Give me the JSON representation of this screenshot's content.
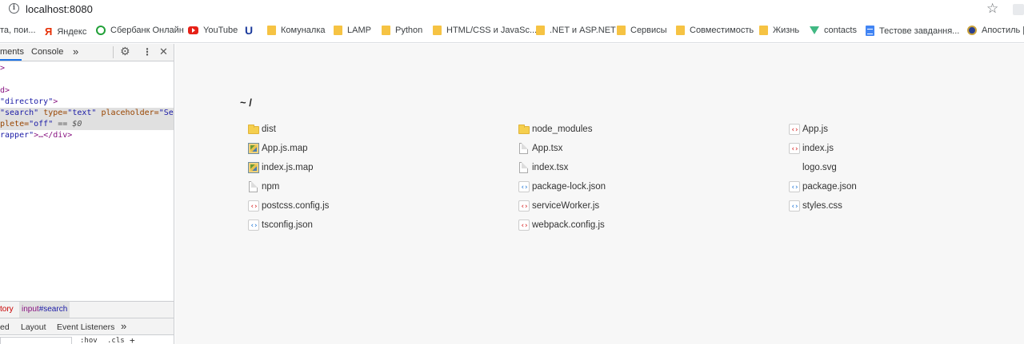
{
  "address_bar": {
    "url": "localhost:8080",
    "info_icon": "info-icon",
    "star_icon": "bookmark-star-icon"
  },
  "bookmarks": [
    {
      "label": "та, пои...",
      "icon": "none"
    },
    {
      "label": "Яндекс",
      "icon": "yandex-icon"
    },
    {
      "label": "Сбербанк Онлайн",
      "icon": "sberbank-icon"
    },
    {
      "label": "YouTube",
      "icon": "youtube-icon"
    },
    {
      "label": "",
      "icon": "u-icon"
    },
    {
      "label": "Комуналка",
      "icon": "folder-icon"
    },
    {
      "label": "LAMP",
      "icon": "folder-icon"
    },
    {
      "label": "Python",
      "icon": "folder-icon"
    },
    {
      "label": "HTML/CSS и JavaSc...",
      "icon": "folder-icon"
    },
    {
      "label": ".NET и ASP.NET",
      "icon": "folder-icon"
    },
    {
      "label": "Сервисы",
      "icon": "folder-icon"
    },
    {
      "label": "Совместимость",
      "icon": "folder-icon"
    },
    {
      "label": "Жизнь",
      "icon": "folder-icon"
    },
    {
      "label": "contacts",
      "icon": "vue-icon"
    },
    {
      "label": "Тестове завдання...",
      "icon": "google-docs-icon"
    },
    {
      "label": "Апостиль | ",
      "icon": "apostille-icon"
    }
  ],
  "devtools": {
    "tabs": {
      "elements": "ments",
      "console": "Console",
      "more": "»"
    },
    "icons": {
      "settings": "⚙",
      "menu": "⋮",
      "close": "✕"
    },
    "code_lines": {
      "l1": ">",
      "l2": "d>",
      "l3_attr_val": "\"directory\"",
      "l3_end": ">",
      "l4_a": "\"search\"",
      "l4_b": " type=",
      "l4_c": "\"text\"",
      "l4_d": " placeholder=",
      "l4_e": "\"Searc",
      "l5_a": "plete=",
      "l5_b": "\"off\"",
      "l5_c": " == $0",
      "l6_a": "rapper\"",
      "l6_b": ">…</div>"
    },
    "breadcrumbs": {
      "prev": "tory",
      "tag": "input",
      "id": "#search"
    },
    "subtabs": {
      "computed": "ed",
      "layout": "Layout",
      "listeners": "Event Listeners",
      "more": "»"
    },
    "filter_row": {
      "hov": ":hov",
      "cls": ".cls",
      "plus": "+"
    }
  },
  "listing": {
    "title": "~ /",
    "columns": [
      [
        {
          "name": "dist",
          "type": "folder"
        },
        {
          "name": "App.js.map",
          "type": "map"
        },
        {
          "name": "index.js.map",
          "type": "map"
        },
        {
          "name": "npm",
          "type": "doc"
        },
        {
          "name": "postcss.config.js",
          "type": "js"
        },
        {
          "name": "tsconfig.json",
          "type": "json"
        }
      ],
      [
        {
          "name": "node_modules",
          "type": "folder"
        },
        {
          "name": "App.tsx",
          "type": "doc"
        },
        {
          "name": "index.tsx",
          "type": "doc"
        },
        {
          "name": "package-lock.json",
          "type": "json"
        },
        {
          "name": "serviceWorker.js",
          "type": "js"
        },
        {
          "name": "webpack.config.js",
          "type": "js"
        }
      ],
      [
        {
          "name": "App.js",
          "type": "js"
        },
        {
          "name": "index.js",
          "type": "js"
        },
        {
          "name": "logo.svg",
          "type": "blank"
        },
        {
          "name": "package.json",
          "type": "json"
        },
        {
          "name": "styles.css",
          "type": "json"
        }
      ]
    ]
  }
}
